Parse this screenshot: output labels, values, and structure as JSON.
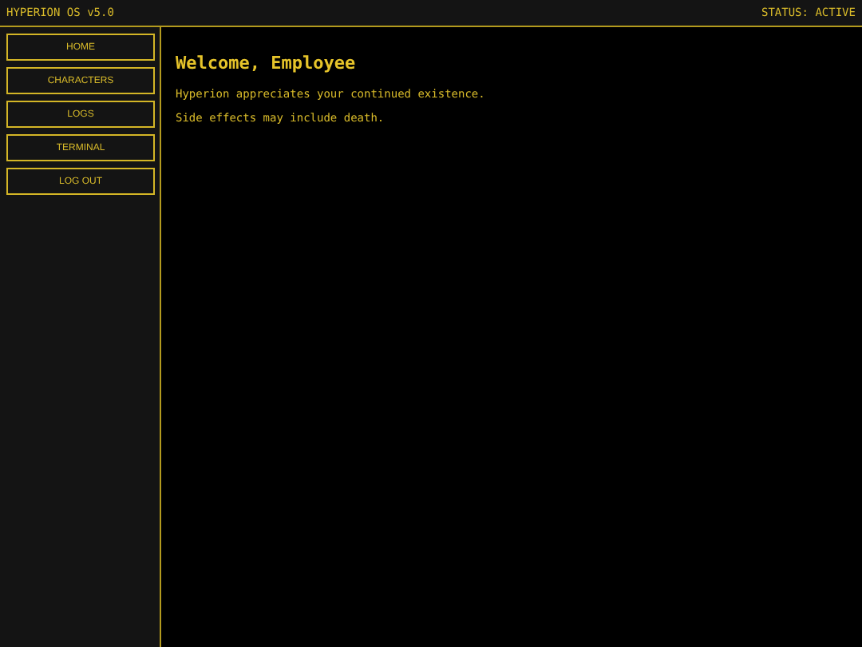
{
  "header": {
    "title": "HYPERION OS v5.0",
    "status": "STATUS: ACTIVE"
  },
  "sidebar": {
    "items": [
      {
        "label": "HOME"
      },
      {
        "label": "CHARACTERS"
      },
      {
        "label": "LOGS"
      },
      {
        "label": "TERMINAL"
      },
      {
        "label": "LOG OUT"
      }
    ]
  },
  "main": {
    "heading": "Welcome, Employee",
    "paragraphs": [
      "Hyperion appreciates your continued existence.",
      "Side effects may include death."
    ]
  }
}
